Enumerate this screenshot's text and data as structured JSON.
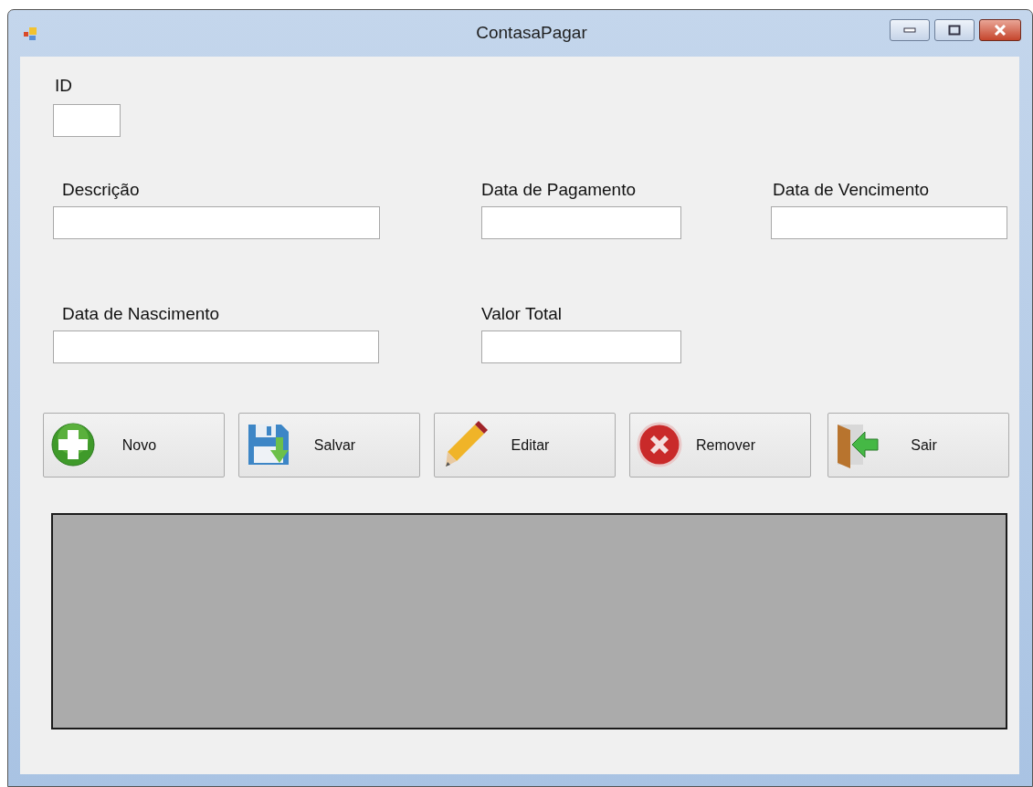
{
  "window": {
    "title": "ContasaPagar"
  },
  "form_rows": [
    [
      {
        "label": "ID"
      }
    ],
    [
      {
        "label": "Descrição"
      },
      {
        "label": "Data de Pagamento"
      },
      {
        "label": "Data de Vencimento"
      }
    ],
    [
      {
        "label": "Data de Nascimento"
      },
      {
        "label": "Valor Total"
      }
    ]
  ],
  "buttons": [
    {
      "label": "Novo"
    },
    {
      "label": "Salvar"
    },
    {
      "label": "Editar"
    },
    {
      "label": "Remover"
    },
    {
      "label": "Sair"
    }
  ]
}
